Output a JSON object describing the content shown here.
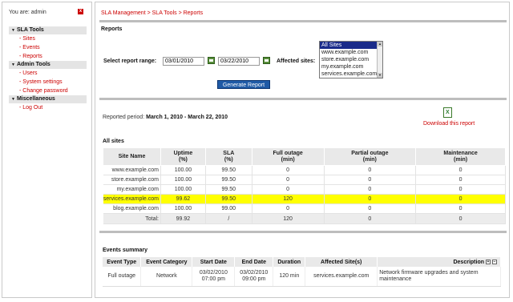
{
  "user": {
    "label": "You are: admin"
  },
  "nav": {
    "groups": [
      {
        "title": "SLA Tools",
        "items": [
          "- Sites",
          "- Events",
          "- Reports"
        ]
      },
      {
        "title": "Admin Tools",
        "items": [
          "- Users",
          "- System settings",
          "- Change password"
        ]
      },
      {
        "title": "Miscellaneous",
        "items": [
          "- Log Out"
        ]
      }
    ]
  },
  "breadcrumb": "SLA Management > SLA Tools > Reports",
  "reports": {
    "title": "Reports",
    "range_label": "Select report range:",
    "date_from": "03/01/2010",
    "date_to": "03/22/2010",
    "sites_label": "Affected sites:",
    "site_options": [
      "All Sites",
      "www.example.com",
      "store.example.com",
      "my.example.com",
      "services.example.com"
    ],
    "selected_site": "All Sites",
    "generate_label": "Generate Report"
  },
  "period": {
    "prefix": "Reported period:",
    "value": "March 1, 2010 - March 22, 2010"
  },
  "download": {
    "label": "Download this report"
  },
  "all_sites": {
    "title": "All sites",
    "columns": [
      "Site Name",
      "Uptime\n(%)",
      "SLA\n(%)",
      "Full outage\n(min)",
      "Partial outage\n(min)",
      "Maintenance\n(min)"
    ],
    "rows": [
      [
        "www.example.com",
        "100.00",
        "99.50",
        "0",
        "0",
        "0"
      ],
      [
        "store.example.com",
        "100.00",
        "99.50",
        "0",
        "0",
        "0"
      ],
      [
        "my.example.com",
        "100.00",
        "99.50",
        "0",
        "0",
        "0"
      ],
      [
        "services.example.com",
        "99.62",
        "99.50",
        "120",
        "0",
        "0"
      ],
      [
        "blog.example.com",
        "100.00",
        "99.00",
        "0",
        "0",
        "0"
      ]
    ],
    "highlight_row": 3,
    "highlight_color": "#ffff00",
    "total": [
      "Total:",
      "99.92",
      "/",
      "120",
      "0",
      "0"
    ]
  },
  "events": {
    "title": "Events summary",
    "columns": [
      "Event Type",
      "Event Category",
      "Start Date",
      "End Date",
      "Duration",
      "Affected Site(s)",
      "Description"
    ],
    "rows": [
      [
        "Full outage",
        "Network",
        "03/02/2010\n07:00 pm",
        "03/02/2010\n09:00 pm",
        "120 min",
        "services.example.com",
        "Network firmware upgrades and system maintenance"
      ]
    ]
  },
  "colors": {
    "link": "#cc0000",
    "button": "#1f5aa6",
    "header_bg": "#e9e9e9"
  }
}
